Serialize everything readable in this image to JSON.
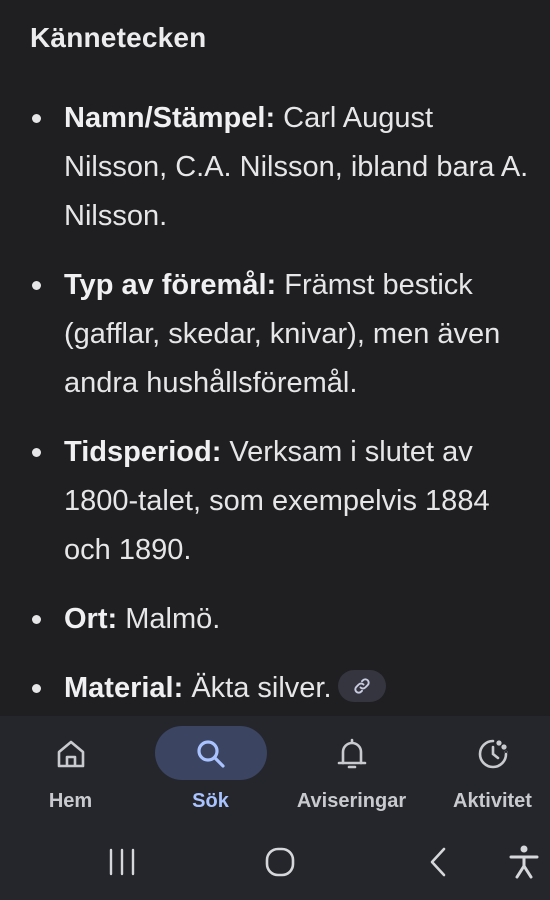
{
  "section": {
    "heading": "Kännetecken"
  },
  "features": [
    {
      "label": "Namn/Stämpel:",
      "text": " Carl August Nilsson, C.A. Nilsson, ibland bara A. Nilsson."
    },
    {
      "label": "Typ av föremål:",
      "text": " Främst bestick (gafflar, skedar, knivar), men även andra hushållsföremål."
    },
    {
      "label": "Tidsperiod:",
      "text": " Verksam i slutet av 1800-talet, som exempelvis 1884 och 1890."
    },
    {
      "label": "Ort:",
      "text": " Malmö."
    },
    {
      "label": "Material:",
      "text": " Äkta silver."
    }
  ],
  "link_chip_icon": "link-icon",
  "bottom_nav": {
    "active": "sok",
    "items": [
      {
        "id": "hem",
        "label": "Hem",
        "icon": "home-icon"
      },
      {
        "id": "sok",
        "label": "Sök",
        "icon": "search-icon"
      },
      {
        "id": "aviseringar",
        "label": "Aviseringar",
        "icon": "bell-icon"
      },
      {
        "id": "aktivitet",
        "label": "Aktivitet",
        "icon": "activity-icon"
      }
    ]
  },
  "system_nav": [
    "recents-icon",
    "home-circle-icon",
    "back-icon",
    "accessibility-icon"
  ],
  "colors": {
    "background": "#1f1f21",
    "nav_background": "#25262c",
    "active_pill": "#3b4460",
    "active_text": "#a8c3ff"
  }
}
